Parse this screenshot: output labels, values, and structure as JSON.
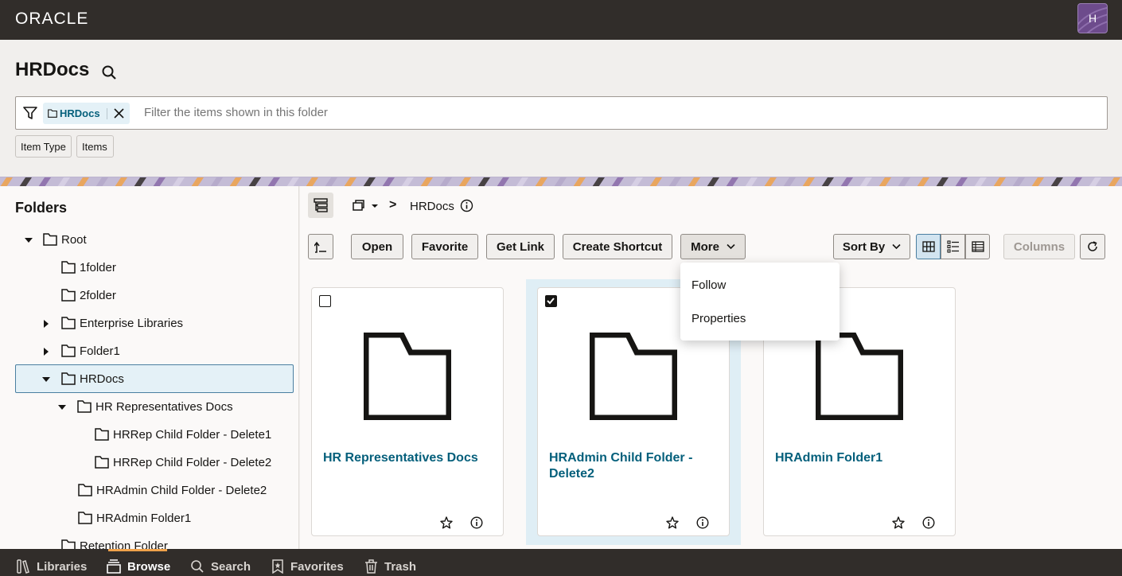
{
  "topbar": {
    "logo": "ORACLE",
    "avatar_initial": "H",
    "brand_color": "#312d2a"
  },
  "header": {
    "title": "HRDocs",
    "filter": {
      "chip_label": "HRDocs",
      "placeholder": "Filter the items shown in this folder"
    },
    "tags": [
      "Item Type",
      "Items"
    ]
  },
  "sidebar": {
    "title": "Folders",
    "nodes": [
      {
        "label": "Root",
        "expanded": true
      },
      {
        "label": "1folder"
      },
      {
        "label": "2folder"
      },
      {
        "label": "Enterprise Libraries",
        "expanded": false
      },
      {
        "label": "Folder1",
        "expanded": false
      },
      {
        "label": "HRDocs",
        "expanded": true,
        "selected": true
      },
      {
        "label": "HR Representatives Docs",
        "expanded": true
      },
      {
        "label": "HRRep Child Folder - Delete1"
      },
      {
        "label": "HRRep Child Folder - Delete2"
      },
      {
        "label": "HRAdmin Child Folder - Delete2"
      },
      {
        "label": "HRAdmin Folder1"
      },
      {
        "label": "Retention Folder"
      }
    ]
  },
  "breadcrumb": {
    "separator": ">",
    "current": "HRDocs"
  },
  "toolbar": {
    "open": "Open",
    "favorite": "Favorite",
    "get_link": "Get Link",
    "create_shortcut": "Create Shortcut",
    "more": "More",
    "sort_by": "Sort By",
    "columns": "Columns"
  },
  "more_menu": {
    "items": [
      "Follow",
      "Properties"
    ]
  },
  "cards": [
    {
      "name": "HR Representatives Docs",
      "checked": false
    },
    {
      "name": "HRAdmin Child Folder - Delete2",
      "checked": true
    },
    {
      "name": "HRAdmin Folder1",
      "checked": false
    }
  ],
  "bottom_nav": {
    "libraries": "Libraries",
    "browse": "Browse",
    "search": "Search",
    "favorites": "Favorites",
    "trash": "Trash",
    "active": "Browse"
  },
  "colors": {
    "accent": "#045f7b",
    "selection": "#e4f1f7",
    "indicator": "#f0a24a"
  }
}
